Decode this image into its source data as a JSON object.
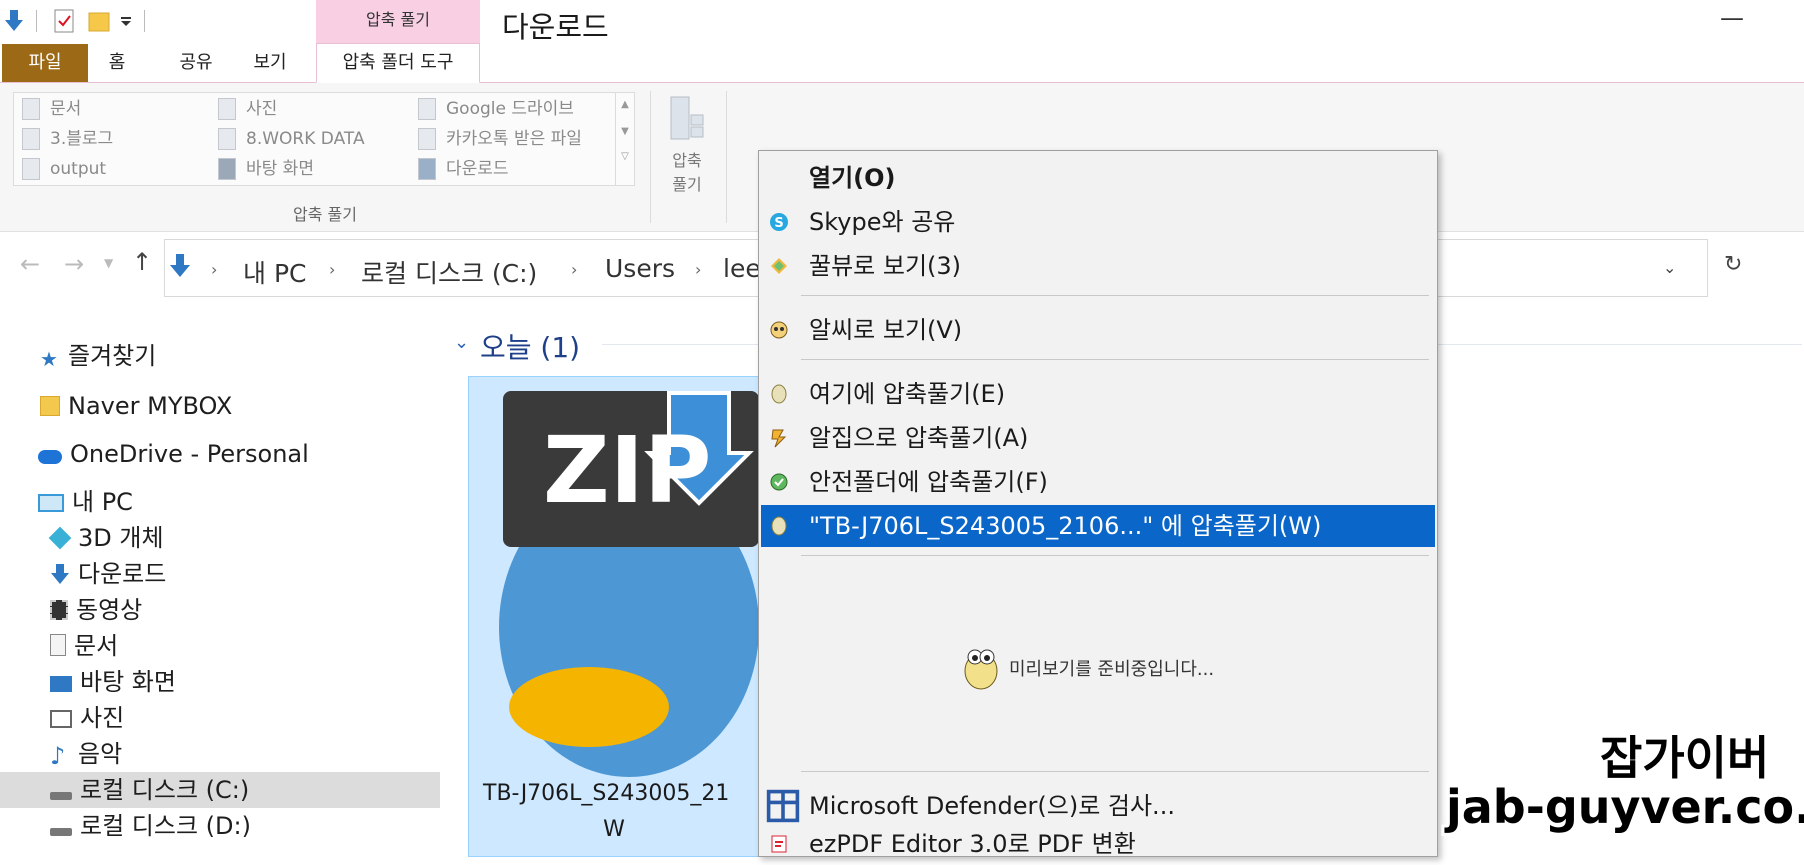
{
  "window": {
    "title": "다운로드",
    "minimize_glyph": "—"
  },
  "ribbon": {
    "context_header": "압축 풀기",
    "tabs": [
      {
        "label": "파일"
      },
      {
        "label": "홈"
      },
      {
        "label": "공유"
      },
      {
        "label": "보기"
      },
      {
        "label": "압축 폴더 도구"
      }
    ],
    "gallery": {
      "col1": [
        "문서",
        "3.블로그",
        "output"
      ],
      "col2": [
        "사진",
        "8.WORK DATA",
        "바탕 화면"
      ],
      "col3": [
        "Google 드라이브",
        "카카오톡 받은 파일",
        "다운로드"
      ]
    },
    "group_label": "압축 풀기",
    "extract_button": {
      "line1": "압축",
      "line2": "풀기"
    }
  },
  "address": {
    "crumbs": [
      "내 PC",
      "로컬 디스크 (C:)",
      "Users",
      "lee"
    ]
  },
  "sidebar": {
    "items": [
      {
        "label": "즐겨찾기",
        "icon": "star-icon",
        "color": "#2f78c4"
      },
      {
        "label": "Naver MYBOX",
        "icon": "mybox-icon",
        "color": "#f2c94c"
      },
      {
        "label": "OneDrive - Personal",
        "icon": "cloud-icon",
        "color": "#1e74d6"
      },
      {
        "label": "내 PC",
        "icon": "computer-icon",
        "color": "#3a9ad9"
      },
      {
        "label": "3D 개체",
        "icon": "cube-icon",
        "color": "#39b0d6"
      },
      {
        "label": "다운로드",
        "icon": "download-arrow-icon",
        "color": "#2f78c4"
      },
      {
        "label": "동영상",
        "icon": "film-icon",
        "color": "#333333"
      },
      {
        "label": "문서",
        "icon": "document-icon",
        "color": "#888888"
      },
      {
        "label": "바탕 화면",
        "icon": "desktop-icon",
        "color": "#2f78c4"
      },
      {
        "label": "사진",
        "icon": "picture-icon",
        "color": "#666666"
      },
      {
        "label": "음악",
        "icon": "music-note-icon",
        "color": "#2f78c4"
      },
      {
        "label": "로컬 디스크 (C:)",
        "icon": "drive-c-icon",
        "color": "#555555"
      },
      {
        "label": "로컬 디스크 (D:)",
        "icon": "drive-d-icon",
        "color": "#555555"
      }
    ]
  },
  "content": {
    "group_header": "오늘 (1)",
    "file": {
      "name_line1": "TB-J706L_S243005_21",
      "name_line2": "W",
      "badge": "ZIP"
    }
  },
  "context_menu": {
    "items": [
      {
        "label": "열기(O)",
        "icon": ""
      },
      {
        "label": "Skype와 공유",
        "icon": "skype-icon"
      },
      {
        "label": "꿀뷰로 보기(3)",
        "icon": "honeyview-icon"
      },
      {
        "label": "알씨로 보기(V)",
        "icon": "alsee-icon"
      },
      {
        "label": "여기에 압축풀기(E)",
        "icon": "bandizip-egg-icon"
      },
      {
        "label": "알집으로 압축풀기(A)",
        "icon": "alzip-icon"
      },
      {
        "label": "안전폴더에 압축풀기(F)",
        "icon": "safe-folder-icon"
      },
      {
        "label": "\"TB-J706L_S243005_2106...\" 에 압축풀기(W)",
        "icon": "bandizip-egg-icon"
      },
      {
        "label": "Microsoft Defender(으)로 검사...",
        "icon": "defender-icon"
      },
      {
        "label": "ezPDF Editor 3.0로 PDF 변환",
        "icon": "ezpdf-icon"
      }
    ],
    "preview_text": "미리보기를 준비중입니다..."
  },
  "watermark": {
    "line1": "잡가이버",
    "line2": "jab-guyver.co.kr"
  },
  "colors": {
    "accent": "#0a66c8",
    "file_tab": "#9c6a16",
    "context_tab": "#f8cfe3"
  }
}
